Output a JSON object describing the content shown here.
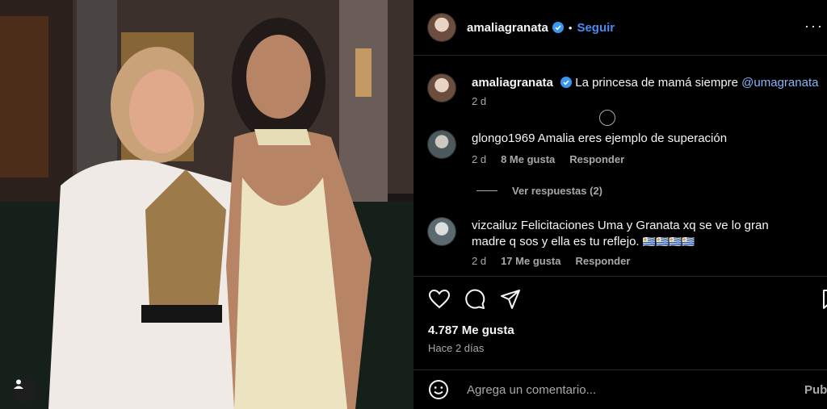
{
  "post": {
    "author": "amaliagranata",
    "follow_label": "Seguir",
    "separator": "•",
    "more_label": "···"
  },
  "caption": {
    "author": "amaliagranata",
    "text": "La princesa de mamá siempre ",
    "mention": "@umagranata",
    "time": "2 d"
  },
  "comments": [
    {
      "user": "glongo1969",
      "text": "Amalia eres ejemplo de superación",
      "time": "2 d",
      "likes": "8 Me gusta",
      "reply": "Responder",
      "view_replies": "Ver respuestas (2)"
    },
    {
      "user": "vizcailuz",
      "text_line1": "Felicitaciones Uma y Granata xq se ve lo gran",
      "text_line2": "madre q sos y ella es tu reflejo.",
      "flags": "🇺🇾🇺🇾🇺🇾🇺🇾",
      "time": "2 d",
      "likes": "17 Me gusta",
      "reply": "Responder"
    }
  ],
  "stats": {
    "likes": "4.787 Me gusta",
    "ago": "Hace 2 días"
  },
  "composer": {
    "placeholder": "Agrega un comentario...",
    "publish_label": "Publica"
  },
  "icons": {
    "like": "heart-icon",
    "comment": "comment-icon",
    "share": "send-icon",
    "save": "bookmark-icon",
    "emoji": "emoji-icon",
    "verified": "verified-badge-icon",
    "user_tag": "person-icon"
  },
  "colors": {
    "link": "#4a8af4",
    "mention": "#8ab4f8",
    "muted": "#a8a8a8",
    "background": "#000000"
  }
}
